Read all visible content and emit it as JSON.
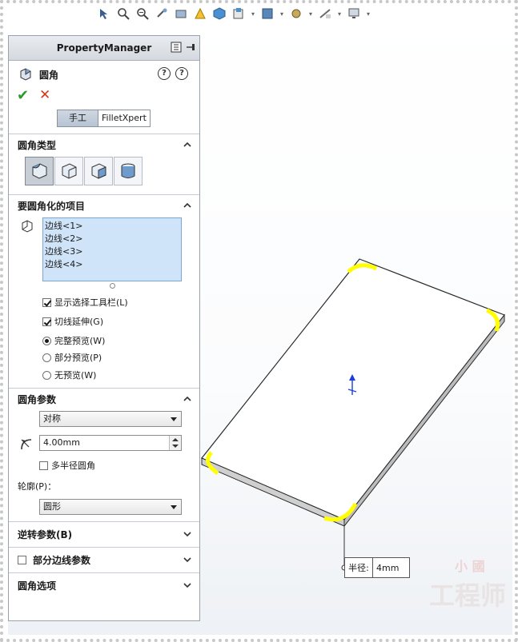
{
  "panel": {
    "header": "PropertyManager",
    "feature_title": "圆角",
    "tabs": {
      "manual": "手工",
      "filletxpert": "FilletXpert"
    },
    "sections": {
      "fillet_type": {
        "title": "圆角类型"
      },
      "items": {
        "title": "要圆角化的项目",
        "edges": [
          "边线<1>",
          "边线<2>",
          "边线<3>",
          "边线<4>"
        ],
        "show_toolbar": {
          "label": "显示选择工具栏(L)",
          "checked": true
        },
        "tangent": {
          "label": "切线延伸(G)",
          "checked": true
        },
        "preview_full": {
          "label": "完整预览(W)",
          "selected": true
        },
        "preview_partial": {
          "label": "部分预览(P)",
          "selected": false
        },
        "preview_none": {
          "label": "无预览(W)",
          "selected": false
        }
      },
      "params": {
        "title": "圆角参数",
        "method": "对称",
        "radius": "4.00mm",
        "multi_radius": {
          "label": "多半径圆角",
          "checked": false
        },
        "profile_label": "轮廓(P)：",
        "profile": "圆形"
      },
      "setback": {
        "title": "逆转参数(B)"
      },
      "partial_edge": {
        "title": "部分边线参数"
      },
      "options": {
        "title": "圆角选项"
      }
    }
  },
  "callout": {
    "key": "半径:",
    "value": "4mm"
  },
  "watermark": {
    "line1": "小 國",
    "line2": "工程师"
  },
  "colors": {
    "accent": "#2c9a2c",
    "cancel": "#d23a1e",
    "highlight": "#ffff00",
    "list_bg": "#cfe4f8"
  }
}
